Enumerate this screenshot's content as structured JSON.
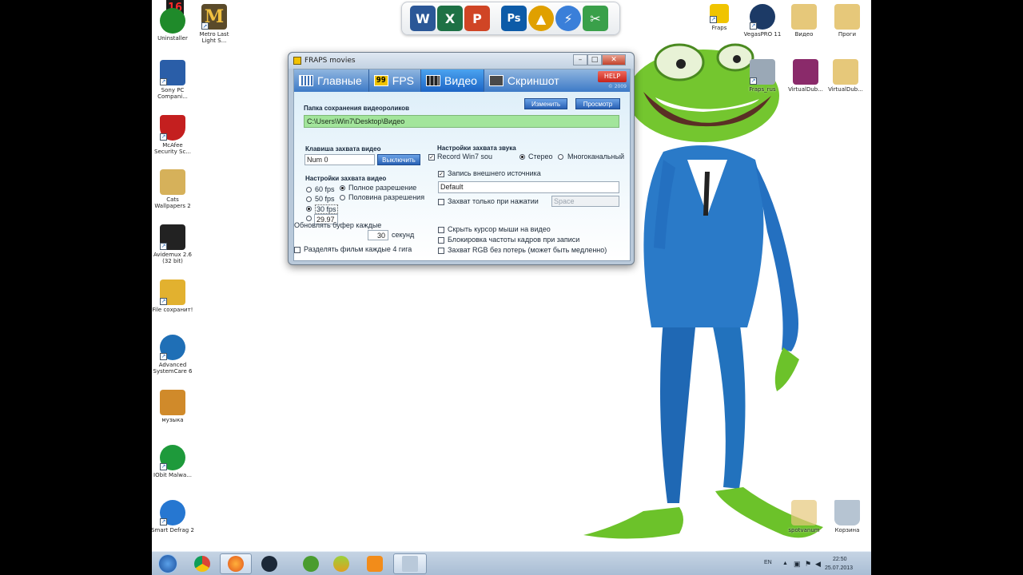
{
  "desktop_left": [
    {
      "name": "icon-uninstaller",
      "label": "Uninstaller",
      "color": "#1f8a2a"
    },
    {
      "name": "icon-sony-pc-companion",
      "label": "Sony PC Compani...",
      "color": "#2a5ea8"
    },
    {
      "name": "icon-mcafee",
      "label": "McAfee Security Sc...",
      "color": "#c41f1f"
    },
    {
      "name": "icon-cats-wallpapers",
      "label": "Cats Wallpapers 2",
      "color": "#d6b15a"
    },
    {
      "name": "icon-avidemux",
      "label": "Avidemux 2.6 (32 bit)",
      "color": "#222222"
    },
    {
      "name": "icon-file-to-pdf",
      "label": "File сохранит!",
      "color": "#e2b12f"
    },
    {
      "name": "icon-advanced-systemcare",
      "label": "Advanced SystemCare 6",
      "color": "#1f6fb6"
    },
    {
      "name": "icon-music",
      "label": "музыка",
      "color": "#d08a2a"
    },
    {
      "name": "icon-iobit-malware",
      "label": "IObit Malwa...",
      "color": "#1e9a3b"
    },
    {
      "name": "icon-smart-defrag",
      "label": "Smart Defrag 2",
      "color": "#2677d1"
    }
  ],
  "desktop_top": [
    {
      "name": "icon-metro-last-light",
      "label": "Metro Last Light S...",
      "color": "#5a4a2a"
    }
  ],
  "desktop_right": [
    {
      "name": "icon-fraps",
      "label": "Fraps",
      "color": "#f0c400"
    },
    {
      "name": "icon-vegas-pro",
      "label": "VegasPRO 11",
      "color": "#1c3a66"
    },
    {
      "name": "icon-video-folder",
      "label": "Видео",
      "color": "#e6c87a"
    },
    {
      "name": "icon-programs-folder",
      "label": "Проги",
      "color": "#e6c87a"
    },
    {
      "name": "icon-fraps-rus",
      "label": "Fraps_rus",
      "color": "#9aa8b6"
    },
    {
      "name": "icon-virtualdub-1",
      "label": "VirtualDub...",
      "color": "#8a2a6a"
    },
    {
      "name": "icon-virtualdub-2",
      "label": "VirtualDub...",
      "color": "#e6c87a"
    },
    {
      "name": "icon-spotvanum",
      "label": "spotvanum",
      "color": "#e6c87a"
    },
    {
      "name": "icon-recycle-bin",
      "label": "Корзина",
      "color": "#b6c4d2"
    }
  ],
  "counter_badge": "16",
  "dock_items": [
    {
      "name": "word-icon",
      "glyph": "W",
      "color": "#2b5797"
    },
    {
      "name": "excel-icon",
      "glyph": "X",
      "color": "#1e7145"
    },
    {
      "name": "powerpoint-icon",
      "glyph": "P",
      "color": "#d04525"
    },
    {
      "name": "photoshop-icon",
      "glyph": "Ps",
      "color": "#0d5ba8"
    },
    {
      "name": "aimp-icon",
      "glyph": "▲",
      "color": "#e0a000"
    },
    {
      "name": "lightning-icon",
      "glyph": "⚡",
      "color": "#3a7fd9"
    },
    {
      "name": "tools-icon",
      "glyph": "✂",
      "color": "#3aa04a"
    }
  ],
  "fraps": {
    "title": "FRAPS movies",
    "tabs": {
      "general": "Главные",
      "fps": "FPS",
      "video": "Видео",
      "screenshot": "Скриншот"
    },
    "fps_badge": "99",
    "help": "HELP",
    "copyright": "© 2009",
    "folder_label": "Папка сохранения видеороликов",
    "change_button": "Изменить",
    "view_button": "Просмотр",
    "folder_path": "C:\\Users\\Win7\\Desktop\\Видео",
    "hotkey_label": "Клавиша захвата видео",
    "hotkey_value": "Num 0",
    "disable_button": "Выключить",
    "video_settings_label": "Настройки захвата видео",
    "fps_60": "60 fps",
    "fps_50": "50 fps",
    "fps_30": "30 fps",
    "fps_custom": "29.97",
    "full_size": "Полное разрешение",
    "half_size": "Половина разрешения",
    "buffer_label": "Обновлять буфер каждые",
    "buffer_value": "30",
    "buffer_unit": "секунд",
    "split_label": "Разделять фильм каждые 4 гига",
    "sound_settings_label": "Настройки захвата звука",
    "record_sound": "Record Win7 sou",
    "stereo": "Стерео",
    "multichannel": "Многоканальный",
    "external_source": "Запись внешнего источника",
    "external_device": "Default",
    "push_to_capture": "Захват только при нажатии",
    "push_key": "Space",
    "hide_cursor": "Скрыть курсор мыши на видео",
    "lock_framerate": "Блокировка частоты кадров при записи",
    "lossless_rgb": "Захват RGB без потерь (может быть медленно)"
  },
  "taskbar": {
    "lang": "EN",
    "time": "22:50",
    "date": "25.07.2013"
  }
}
